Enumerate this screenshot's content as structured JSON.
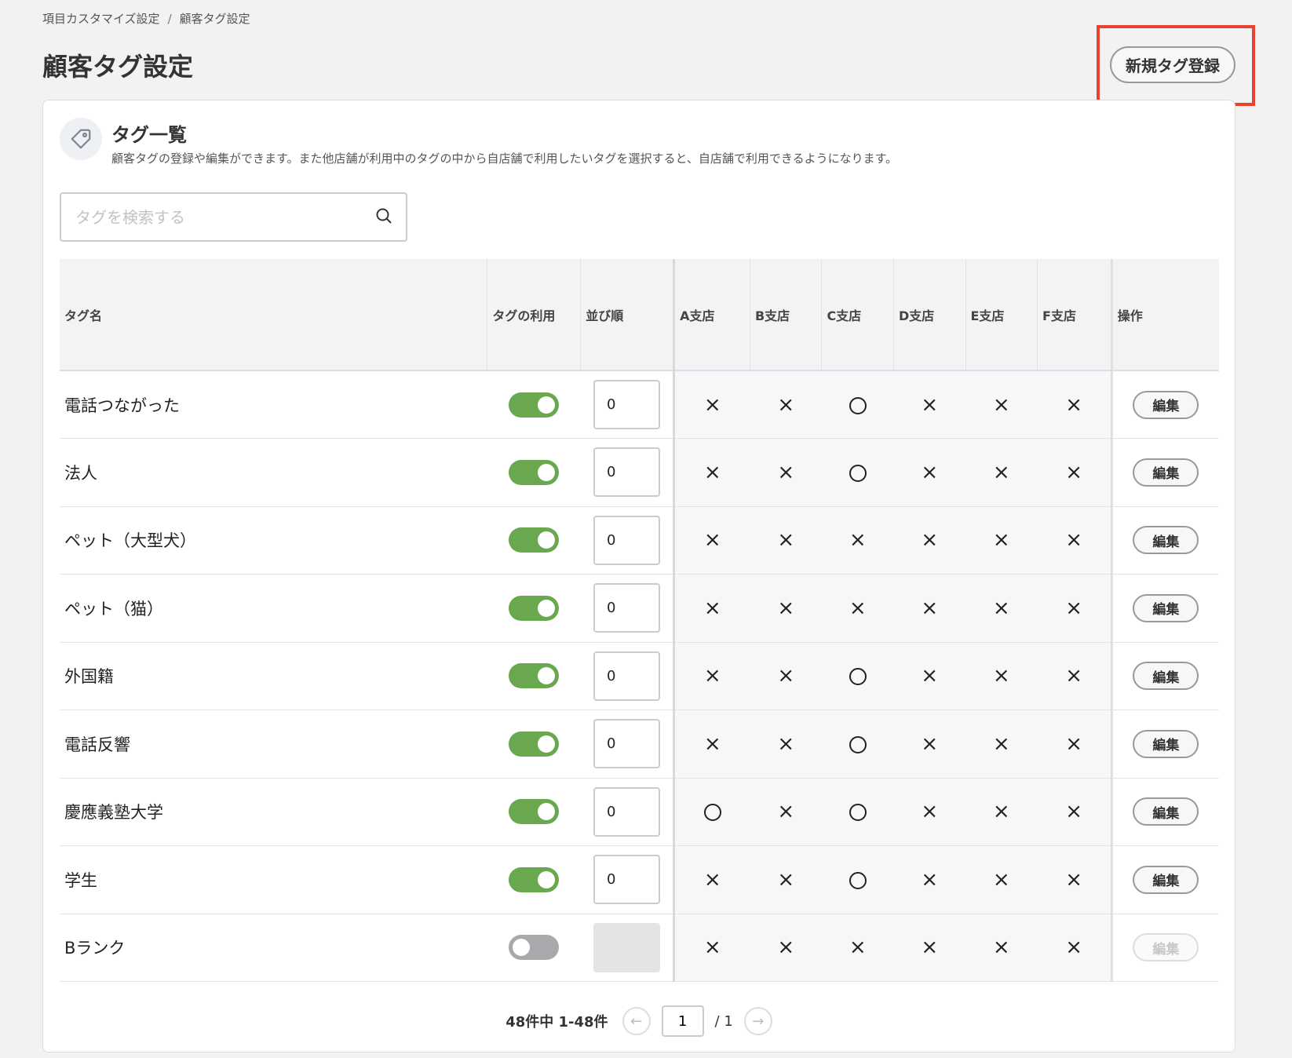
{
  "breadcrumb": {
    "parent": "項目カスタマイズ設定",
    "separator": "/",
    "current": "顧客タグ設定"
  },
  "page_title": "顧客タグ設定",
  "new_tag_button": "新規タグ登録",
  "card": {
    "title": "タグ一覧",
    "description": "顧客タグの登録や編集ができます。また他店舗が利用中のタグの中から自店舗で利用したいタグを選択すると、自店舗で利用できるようになります。",
    "icon": "tag-icon"
  },
  "search": {
    "placeholder": "タグを検索する",
    "value": "",
    "icon": "search-icon"
  },
  "table": {
    "headers": {
      "name": "タグ名",
      "usage": "タグの利用",
      "order": "並び順",
      "shops": [
        "A支店",
        "B支店",
        "C支店",
        "D支店",
        "E支店",
        "F支店"
      ],
      "ops": "操作"
    },
    "edit_label": "編集",
    "rows": [
      {
        "name": "電話つながった",
        "enabled": true,
        "order": "0",
        "shops": [
          "×",
          "×",
          "○",
          "×",
          "×",
          "×"
        ]
      },
      {
        "name": "法人",
        "enabled": true,
        "order": "0",
        "shops": [
          "×",
          "×",
          "○",
          "×",
          "×",
          "×"
        ]
      },
      {
        "name": "ペット（大型犬）",
        "enabled": true,
        "order": "0",
        "shops": [
          "×",
          "×",
          "×",
          "×",
          "×",
          "×"
        ]
      },
      {
        "name": "ペット（猫）",
        "enabled": true,
        "order": "0",
        "shops": [
          "×",
          "×",
          "×",
          "×",
          "×",
          "×"
        ]
      },
      {
        "name": "外国籍",
        "enabled": true,
        "order": "0",
        "shops": [
          "×",
          "×",
          "○",
          "×",
          "×",
          "×"
        ]
      },
      {
        "name": "電話反響",
        "enabled": true,
        "order": "0",
        "shops": [
          "×",
          "×",
          "○",
          "×",
          "×",
          "×"
        ]
      },
      {
        "name": "慶應義塾大学",
        "enabled": true,
        "order": "0",
        "shops": [
          "○",
          "×",
          "○",
          "×",
          "×",
          "×"
        ]
      },
      {
        "name": "学生",
        "enabled": true,
        "order": "0",
        "shops": [
          "×",
          "×",
          "○",
          "×",
          "×",
          "×"
        ]
      },
      {
        "name": "Bランク",
        "enabled": false,
        "order": "",
        "shops": [
          "×",
          "×",
          "×",
          "×",
          "×",
          "×"
        ]
      }
    ]
  },
  "pagination": {
    "summary": "48件中 1-48件",
    "page": "1",
    "total": "/ 1"
  },
  "colors": {
    "toggle_on": "#6aa84f",
    "highlight": "#e8412e"
  }
}
